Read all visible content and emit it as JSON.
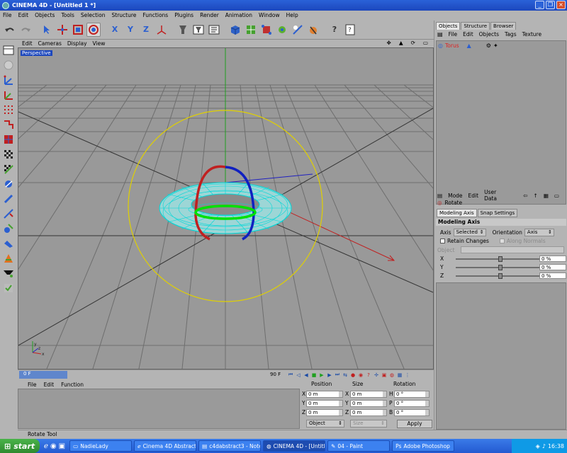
{
  "window": {
    "title": "CINEMA 4D - [Untitled 1 *]"
  },
  "menubar": [
    "File",
    "Edit",
    "Objects",
    "Tools",
    "Selection",
    "Structure",
    "Functions",
    "Plugins",
    "Render",
    "Animation",
    "Window",
    "Help"
  ],
  "toolbar_icons": [
    "undo-icon",
    "redo-icon",
    "select-arrow-icon",
    "move-icon",
    "scale-icon",
    "rotate-icon",
    "x-axis-icon",
    "y-axis-icon",
    "z-axis-icon",
    "world-coords-icon",
    "render-view-icon",
    "render-picture-viewer-icon",
    "render-settings-icon",
    "cube-icon",
    "subdivision-icon",
    "array-icon",
    "nurbs-icon",
    "light-icon",
    "deformer-icon",
    "help-icon",
    "info-icon"
  ],
  "viewport": {
    "menu": [
      "Edit",
      "Cameras",
      "Display",
      "View"
    ],
    "label": "Perspective",
    "nav_icons": [
      "move-view-icon",
      "zoom-view-icon",
      "rotate-view-icon",
      "maximize-icon"
    ]
  },
  "timeline": {
    "current_frame": "0 F",
    "end_frame": "90 F"
  },
  "material_manager": {
    "menu": [
      "File",
      "Edit",
      "Function"
    ]
  },
  "coordinates": {
    "headers": {
      "position": "Position",
      "size": "Size",
      "rotation": "Rotation"
    },
    "rows": [
      {
        "axis": "X",
        "position": "0 m",
        "size_axis": "X",
        "size": "0 m",
        "rot_axis": "H",
        "rotation": "0 °"
      },
      {
        "axis": "Y",
        "position": "0 m",
        "size_axis": "Y",
        "size": "0 m",
        "rot_axis": "P",
        "rotation": "0 °"
      },
      {
        "axis": "Z",
        "position": "0 m",
        "size_axis": "Z",
        "size": "0 m",
        "rot_axis": "B",
        "rotation": "0 °"
      }
    ],
    "mode": "Object",
    "size_mode": "Size",
    "apply": "Apply"
  },
  "status": "Rotate Tool",
  "object_manager": {
    "tabs": [
      "Objects",
      "Structure",
      "Browser"
    ],
    "active_tab": "Objects",
    "menu": [
      "File",
      "Edit",
      "Objects",
      "Tags",
      "Texture"
    ],
    "objects": [
      {
        "name": "Torus"
      }
    ]
  },
  "attribute_manager": {
    "menu": [
      "Mode",
      "Edit",
      "User Data"
    ],
    "tool_name": "Rotate",
    "tabs": [
      "Modeling Axis",
      "Snap Settings"
    ],
    "active_tab": "Modeling Axis",
    "section": "Modeling Axis",
    "axis_label": "Axis",
    "axis_value": "Selected",
    "orientation_label": "Orientation",
    "orientation_value": "Axis",
    "retain_changes": "Retain Changes",
    "along_normals": "Along Normals",
    "object_label": "Object",
    "sliders": [
      {
        "axis": "X",
        "value": "0 %"
      },
      {
        "axis": "Y",
        "value": "0 %"
      },
      {
        "axis": "Z",
        "value": "0 %"
      }
    ]
  },
  "taskbar": {
    "start": "start",
    "tasks": [
      {
        "label": "NadieLady",
        "active": false
      },
      {
        "label": "Cinema 4D Abstract...",
        "active": false
      },
      {
        "label": "c4dabstract3 - Note...",
        "active": false
      },
      {
        "label": "CINEMA 4D - [Untitl...",
        "active": true
      },
      {
        "label": "04 - Paint",
        "active": false
      },
      {
        "label": "Adobe Photoshop",
        "active": false
      }
    ],
    "clock": "16:38"
  }
}
